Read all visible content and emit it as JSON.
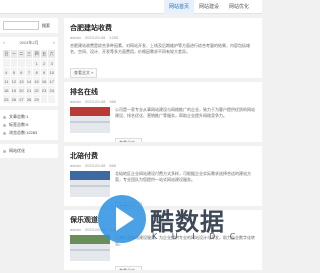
{
  "nav": {
    "items": [
      {
        "label": "网站首页",
        "active": true
      },
      {
        "label": "网站建设",
        "active": false
      },
      {
        "label": "网站优化",
        "active": false
      }
    ]
  },
  "sidebar": {
    "search": {
      "placeholder": "",
      "button_label": "搜索"
    },
    "calendar": {
      "title": "2024年2月",
      "prev": "«",
      "next": "»",
      "weekdays": [
        "日",
        "一",
        "二",
        "三",
        "四",
        "五",
        "六"
      ],
      "days": [
        "",
        "",
        "",
        "",
        "1",
        "2",
        "3",
        "4",
        "5",
        "6",
        "7",
        "8",
        "9",
        "10",
        "11",
        "12",
        "13",
        "14",
        "15",
        "16",
        "17",
        "18",
        "19",
        "20",
        "21",
        "22",
        "23",
        "24",
        "25",
        "26",
        "27",
        "28",
        "29",
        "",
        ""
      ]
    },
    "stats": [
      {
        "label": "文章总数:1"
      },
      {
        "label": "标签总数:5"
      },
      {
        "label": "浏览总数:12283"
      }
    ],
    "links": [
      {
        "label": "网站优化"
      }
    ]
  },
  "posts": [
    {
      "title": "合肥建站收费",
      "author": "admin",
      "date": "2023-09-08",
      "views": "1200",
      "excerpt": "合肥建站收费是综合多种因素，对网站开发、上线及后期维护等方面进行综合考量的结果，内容包括域名、空间、设计、开发等多方面费用，价格因需求不同有较大差异。",
      "readmore": "查看全文 »",
      "has_thumb": false
    },
    {
      "title": "排名在线",
      "author": "admin",
      "date": "2023-09-08",
      "views": "980",
      "excerpt": "公司是一家专业从事网站建设与网络推广的企业，致力于为客户提供优质的网站建设、排名优化、营销推广等服务，帮助企业提升网络竞争力。",
      "readmore": "查看全文 »",
      "has_thumb": true,
      "thumb_color": "#b93a35"
    },
    {
      "title": "北碚付费",
      "author": "admin",
      "date": "2023-09-08",
      "views": "860",
      "excerpt": "北碚地区企业网站建设付费方式多样，可根据企业实际需求选择合适的建站方案，专业团队为您提供一站式网站建设服务。",
      "readmore": "查看全文 »",
      "has_thumb": true,
      "thumb_color": "#3d6aa3"
    },
    {
      "title": "保乐观道",
      "author": "admin",
      "date": "2023-09-08",
      "views": "740",
      "excerpt": "上海行业网站建设服务，为企业提供专业的网站设计与开发，助力企业数字化转型。",
      "readmore": "查看全文 »",
      "has_thumb": true,
      "thumb_color": "#6a8e5a"
    }
  ],
  "watermark": {
    "text": "酷数据",
    "sub": "K U I D C"
  }
}
